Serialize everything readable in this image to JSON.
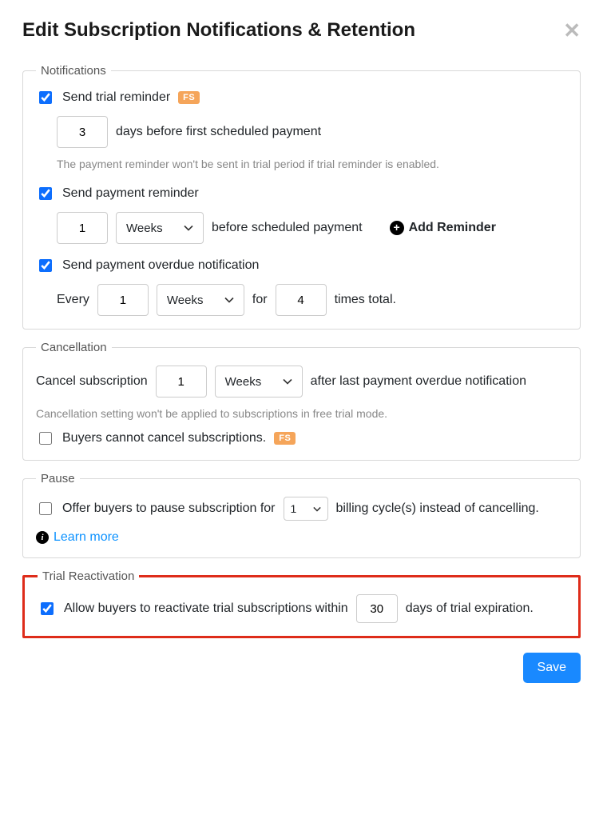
{
  "header": {
    "title": "Edit Subscription Notifications & Retention"
  },
  "notifications": {
    "legend": "Notifications",
    "trial_reminder": {
      "label": "Send trial reminder",
      "checked": true,
      "badge": "FS",
      "days_value": "3",
      "days_suffix": "days before first scheduled payment"
    },
    "trial_help": "The payment reminder won't be sent in trial period if trial reminder is enabled.",
    "payment_reminder": {
      "label": "Send payment reminder",
      "checked": true,
      "count_value": "1",
      "unit_value": "Weeks",
      "suffix": "before scheduled payment",
      "add_reminder_label": "Add Reminder"
    },
    "overdue": {
      "label": "Send payment overdue notification",
      "checked": true,
      "every_label": "Every",
      "every_value": "1",
      "unit_value": "Weeks",
      "for_label": "for",
      "times_value": "4",
      "times_suffix": "times total."
    }
  },
  "cancellation": {
    "legend": "Cancellation",
    "prefix": "Cancel subscription",
    "count_value": "1",
    "unit_value": "Weeks",
    "suffix": "after last payment overdue notification",
    "help": "Cancellation setting won't be applied to subscriptions in free trial mode.",
    "buyers_cannot": {
      "checked": false,
      "label": "Buyers cannot cancel subscriptions.",
      "badge": "FS"
    }
  },
  "pause": {
    "legend": "Pause",
    "checked": false,
    "prefix": "Offer buyers to pause subscription for",
    "cycles_value": "1",
    "suffix": "billing cycle(s) instead of cancelling.",
    "learn_more": "Learn more"
  },
  "trial_reactivation": {
    "legend": "Trial Reactivation",
    "checked": true,
    "prefix": "Allow buyers to reactivate trial subscriptions within",
    "days_value": "30",
    "suffix": "days of trial expiration."
  },
  "footer": {
    "save_label": "Save"
  }
}
